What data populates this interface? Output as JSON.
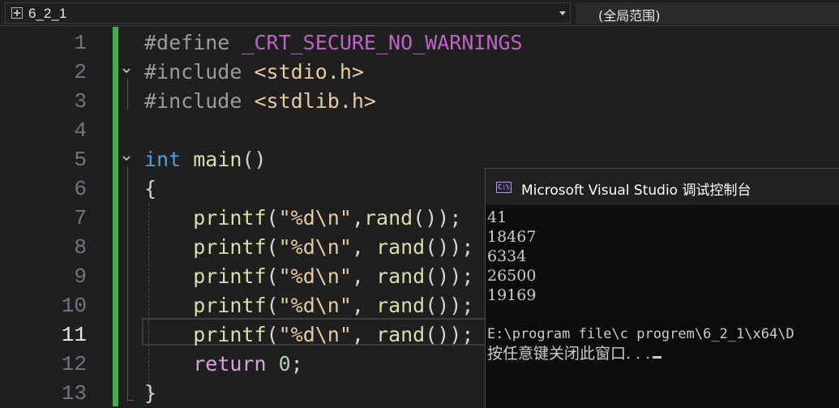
{
  "navbar": {
    "project": "6_2_1",
    "scope": "(全局范围)"
  },
  "editor": {
    "current_line": "11",
    "lines": [
      {
        "number": "1",
        "tokens": [
          {
            "t": "#define ",
            "c": "pp"
          },
          {
            "t": "_CRT_SECURE_NO_WARNINGS",
            "c": "macro"
          }
        ]
      },
      {
        "number": "2",
        "tokens": [
          {
            "t": "#include ",
            "c": "pp"
          },
          {
            "t": "<stdio.h>",
            "c": "str"
          }
        ]
      },
      {
        "number": "3",
        "tokens": [
          {
            "t": "#include ",
            "c": "pp"
          },
          {
            "t": "<stdlib.h>",
            "c": "str"
          }
        ]
      },
      {
        "number": "4",
        "tokens": []
      },
      {
        "number": "5",
        "tokens": [
          {
            "t": "int",
            "c": "kw"
          },
          {
            "t": " ",
            "c": "p"
          },
          {
            "t": "main",
            "c": "fn"
          },
          {
            "t": "()",
            "c": "p"
          }
        ]
      },
      {
        "number": "6",
        "tokens": [
          {
            "t": "{",
            "c": "p"
          }
        ]
      },
      {
        "number": "7",
        "tokens": [
          {
            "t": "    ",
            "c": "p"
          },
          {
            "t": "printf",
            "c": "fn"
          },
          {
            "t": "(",
            "c": "p"
          },
          {
            "t": "\"%d\\n\"",
            "c": "str"
          },
          {
            "t": ",",
            "c": "p"
          },
          {
            "t": "rand",
            "c": "fn"
          },
          {
            "t": "());",
            "c": "p"
          }
        ]
      },
      {
        "number": "8",
        "tokens": [
          {
            "t": "    ",
            "c": "p"
          },
          {
            "t": "printf",
            "c": "fn"
          },
          {
            "t": "(",
            "c": "p"
          },
          {
            "t": "\"%d\\n\"",
            "c": "str"
          },
          {
            "t": ", ",
            "c": "p"
          },
          {
            "t": "rand",
            "c": "fn"
          },
          {
            "t": "());",
            "c": "p"
          }
        ]
      },
      {
        "number": "9",
        "tokens": [
          {
            "t": "    ",
            "c": "p"
          },
          {
            "t": "printf",
            "c": "fn"
          },
          {
            "t": "(",
            "c": "p"
          },
          {
            "t": "\"%d\\n\"",
            "c": "str"
          },
          {
            "t": ", ",
            "c": "p"
          },
          {
            "t": "rand",
            "c": "fn"
          },
          {
            "t": "());",
            "c": "p"
          }
        ]
      },
      {
        "number": "10",
        "tokens": [
          {
            "t": "    ",
            "c": "p"
          },
          {
            "t": "printf",
            "c": "fn"
          },
          {
            "t": "(",
            "c": "p"
          },
          {
            "t": "\"%d\\n\"",
            "c": "str"
          },
          {
            "t": ", ",
            "c": "p"
          },
          {
            "t": "rand",
            "c": "fn"
          },
          {
            "t": "());",
            "c": "p"
          }
        ]
      },
      {
        "number": "11",
        "tokens": [
          {
            "t": "    ",
            "c": "p"
          },
          {
            "t": "printf",
            "c": "fn"
          },
          {
            "t": "(",
            "c": "p"
          },
          {
            "t": "\"%d\\n\"",
            "c": "str"
          },
          {
            "t": ", ",
            "c": "p"
          },
          {
            "t": "rand",
            "c": "fn"
          },
          {
            "t": "());",
            "c": "p"
          }
        ]
      },
      {
        "number": "12",
        "tokens": [
          {
            "t": "    ",
            "c": "p"
          },
          {
            "t": "return",
            "c": "ret"
          },
          {
            "t": " ",
            "c": "p"
          },
          {
            "t": "0",
            "c": "num"
          },
          {
            "t": ";",
            "c": "p"
          }
        ]
      },
      {
        "number": "13",
        "tokens": [
          {
            "t": "}",
            "c": "p"
          }
        ]
      }
    ]
  },
  "console": {
    "title": "Microsoft Visual Studio 调试控制台",
    "icon_text": "C:\\",
    "output": [
      "41",
      "18467",
      "6334",
      "26500",
      "19169"
    ],
    "exit_line": "E:\\program file\\c progrem\\6_2_1\\x64\\D",
    "prompt": "按任意键关闭此窗口. . ."
  }
}
